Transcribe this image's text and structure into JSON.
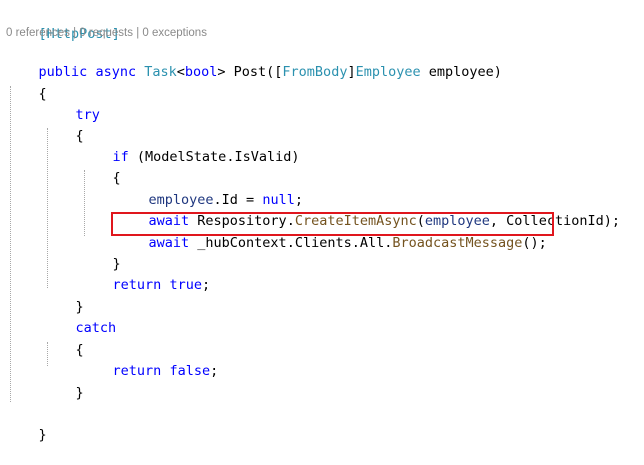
{
  "editor": {
    "codelens": "0 references | 0 requests | 0 exceptions",
    "tokens": {
      "attr_open": "[",
      "attr_httppost": "HttpPost",
      "attr_close": "]",
      "public": "public",
      "async": "async",
      "task": "Task",
      "lt": "<",
      "bool": "bool",
      "gt_post": "> Post([",
      "frombody": "FromBody",
      "bracket_close": "]",
      "employee_type": "Employee",
      "employee_param": " employee)",
      "brace_open": "{",
      "brace_close": "}",
      "try": "try",
      "if": "if",
      "if_cond": " (ModelState.IsValid)",
      "employee_id": "employee",
      "dot_id_eq": ".Id = ",
      "null": "null",
      "semicolon": ";",
      "await": "await",
      "respository": " Respository.",
      "create_item": "CreateItemAsync",
      "create_args_open": "(",
      "employee_arg": "employee",
      "create_args_rest": ", CollectionId);",
      "hub_context": " _hubContext.Clients.All.",
      "broadcast": "BroadcastMessage",
      "call_end": "();",
      "return": "return",
      "true": "true",
      "false": "false",
      "catch": "catch"
    },
    "highlight_color": "#e0161d"
  }
}
